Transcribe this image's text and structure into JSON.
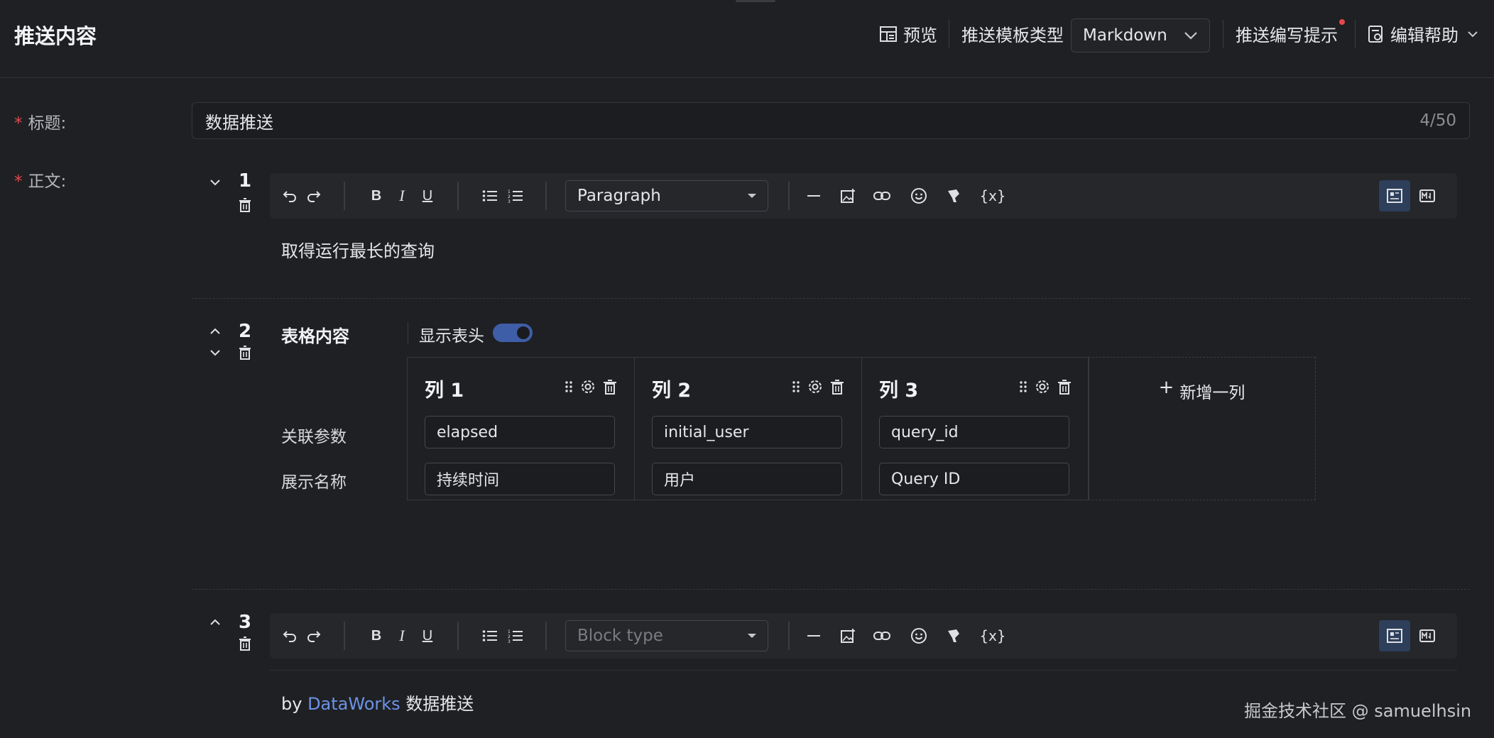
{
  "header": {
    "title": "推送内容",
    "preview_label": "预览",
    "template_type_label": "推送模板类型",
    "template_type_value": "Markdown",
    "write_tips_label": "推送编写提示",
    "edit_help_label": "编辑帮助"
  },
  "form": {
    "title_label": "标题:",
    "title_value": "数据推送",
    "title_count": "4/50",
    "body_label": "正文:"
  },
  "blocks": [
    {
      "number": "1",
      "block_type": "Paragraph",
      "content": "取得运行最长的查询"
    },
    {
      "number": "2",
      "title": "表格内容",
      "show_header_label": "显示表头",
      "show_header_on": true,
      "row_labels": [
        "关联参数",
        "展示名称"
      ],
      "columns": [
        {
          "title": "列 1",
          "param": "elapsed",
          "display": "持续时间"
        },
        {
          "title": "列 2",
          "param": "initial_user",
          "display": "用户"
        },
        {
          "title": "列 3",
          "param": "query_id",
          "display": "Query ID"
        }
      ],
      "add_column_label": "新增一列"
    },
    {
      "number": "3",
      "block_type_placeholder": "Block type",
      "content_prefix": "by",
      "content_link": "DataWorks",
      "content_suffix": "数据推送"
    }
  ],
  "toolbar": {
    "bold": "B",
    "italic": "I",
    "underline": "U",
    "variable": "{x}"
  },
  "watermark": "掘金技术社区 @ samuelhsin",
  "colors": {
    "background": "#1f2023",
    "accent": "#3f5ea8",
    "link": "#6c93e8",
    "required": "#e5484d"
  }
}
